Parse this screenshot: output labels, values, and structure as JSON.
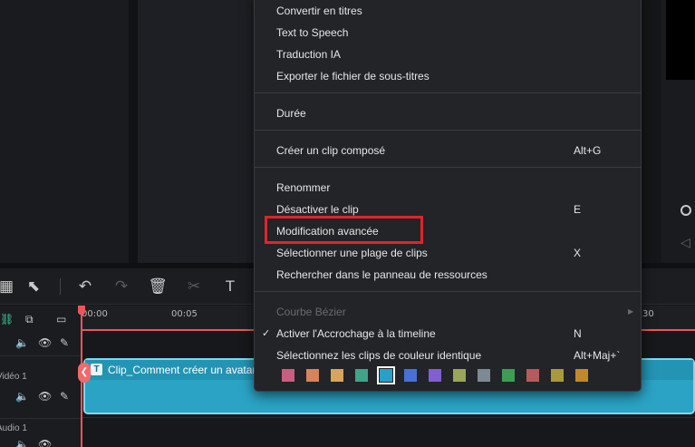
{
  "context_menu": {
    "items": {
      "convert_titles": "Convertir en titres",
      "tts": "Text to Speech",
      "ai_translate": "Traduction IA",
      "export_subtitles": "Exporter le fichier de sous-titres",
      "duration": "Durée",
      "compound_clip": "Créer un clip composé",
      "rename": "Renommer",
      "disable_clip": "Désactiver le clip",
      "advanced_edit": "Modification avancée",
      "select_range": "Sélectionner une plage de clips",
      "search_resources": "Rechercher dans le panneau de ressources",
      "bezier": "Courbe Bézier",
      "snap_timeline": "Activer l'Accrochage à la timeline",
      "select_same_color": "Sélectionnez les clips de couleur identique"
    },
    "shortcuts": {
      "compound_clip": "Alt+G",
      "disable_clip": "E",
      "select_range": "X",
      "snap_timeline": "N",
      "select_same_color": "Alt+Maj+`"
    },
    "check_mark": "✓",
    "color_swatches": [
      "#c7607f",
      "#d9825c",
      "#d6a65a",
      "#3fa58a",
      "#2aa0c6",
      "#4a6fd6",
      "#7f5fd1",
      "#9aa55c",
      "#7c8a93",
      "#3f9c55",
      "#b85a5a",
      "#a89a3a",
      "#c08a2a"
    ],
    "selected_swatch_index": 4
  },
  "timeline": {
    "ruler_times": [
      "00:00",
      "00:05",
      "30"
    ],
    "clip_label": "Clip_Comment créer un avatar",
    "clip_badge": "T",
    "tracks": {
      "video": "Vidéo 1",
      "audio": "Audio 1"
    }
  },
  "colors": {
    "accent": "#e8575a",
    "clip": "#2ba3c4",
    "highlight_box": "#e0242b"
  }
}
